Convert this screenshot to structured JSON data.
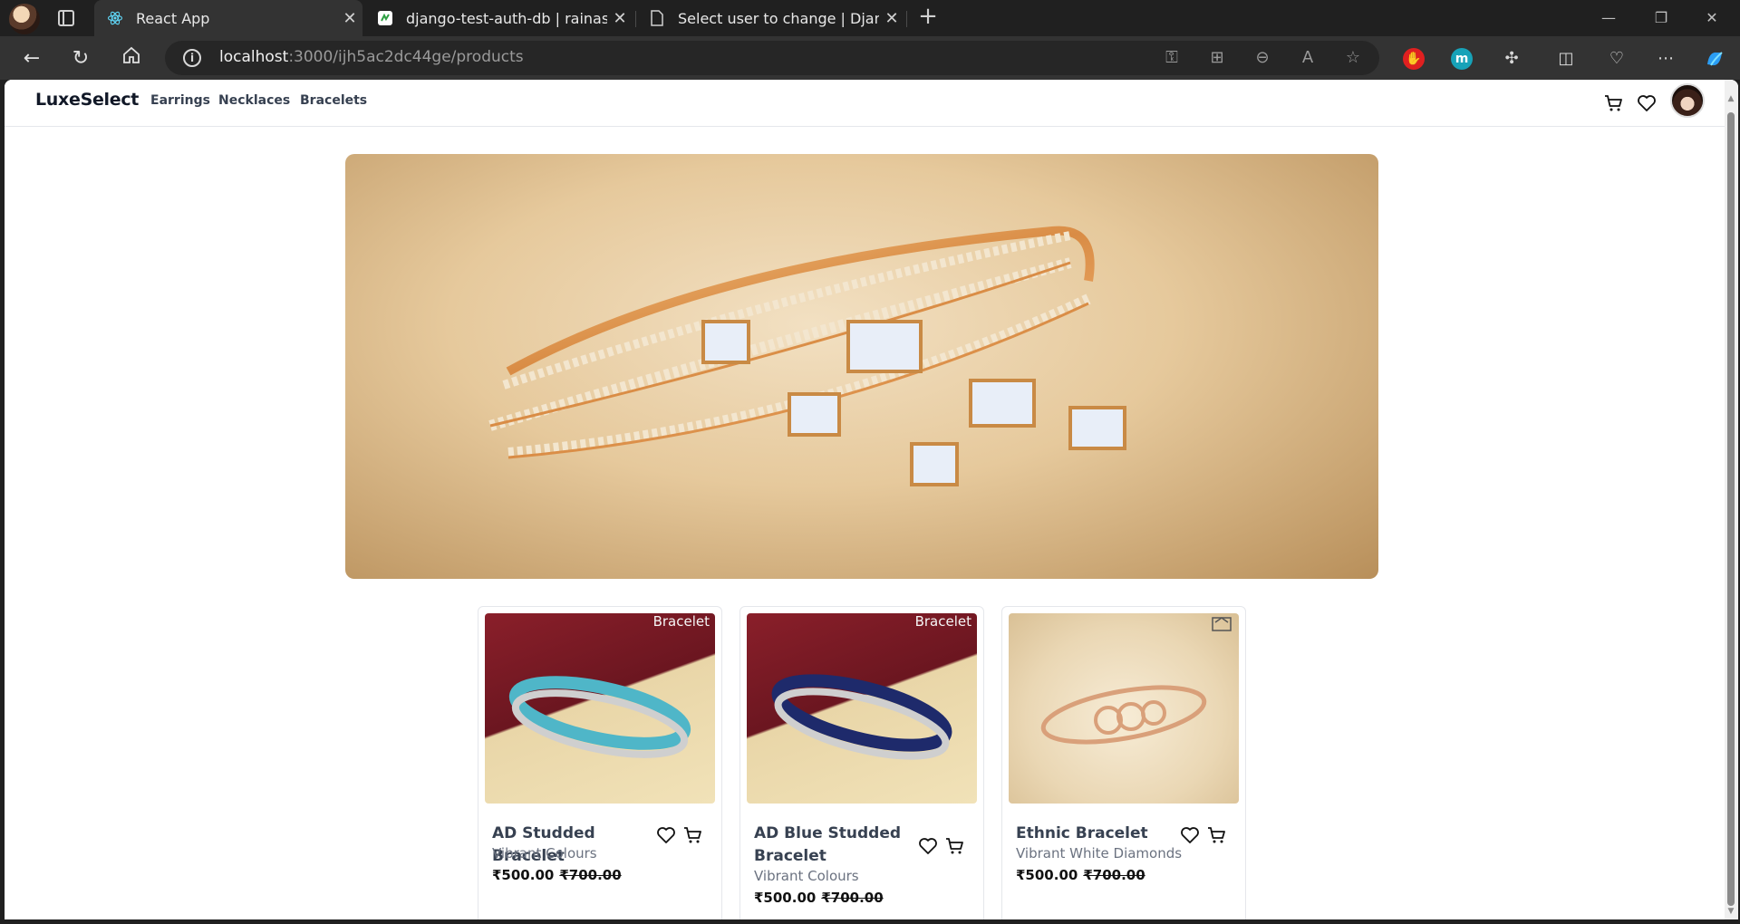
{
  "browser": {
    "tabs": [
      {
        "title": "React App",
        "active": true
      },
      {
        "title": "django-test-auth-db | rainasaxena",
        "active": false
      },
      {
        "title": "Select user to change | Django site admin",
        "active": false
      }
    ],
    "url": {
      "host": "localhost",
      "path": ":3000/ijh5ac2dc44ge/products"
    }
  },
  "site": {
    "brand": "LuxeSelect",
    "nav_links": [
      "Earrings",
      "Necklaces",
      "Bracelets"
    ]
  },
  "products": [
    {
      "tag": "Bracelet",
      "title": "AD Studded Bracelet",
      "subtitle": "Vibrant Colours",
      "price": "₹500.00",
      "old_price": "₹700.00",
      "accent": "#4fb6c8"
    },
    {
      "tag": "Bracelet",
      "title": "AD Blue Studded Bracelet",
      "subtitle": "Vibrant Colours",
      "price": "₹500.00",
      "old_price": "₹700.00",
      "accent": "#1e2a6b"
    },
    {
      "tag": "",
      "title": "Ethnic Bracelet",
      "subtitle": "Vibrant White Diamonds",
      "price": "₹500.00",
      "old_price": "₹700.00",
      "accent": "#d9a07a"
    }
  ],
  "colors": {
    "brand_text": "#111827",
    "link_text": "#374151",
    "muted": "#6b7280"
  }
}
